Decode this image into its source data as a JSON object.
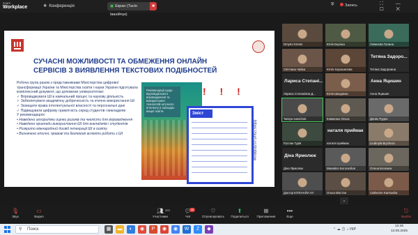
{
  "app": {
    "logo_line1": "zoom",
    "logo_line2": "Workplace",
    "conference_label": "Конференція",
    "screen_share_label": "Екран (Тасія Іванійчук)"
  },
  "topbar": {
    "record_label": "Запись"
  },
  "slide": {
    "title": "СУЧАСНІ МОЖЛИВОСТІ ТА ОБМЕЖЕННЯ ОНЛАЙН СЕРВІСІВ З ВИЯВЛЕННЯ ТЕКСТОВИХ ПОДІБНОСТЕЙ",
    "paragraph": "Робоча група разом з представниками Міністерства цифрової трансформації України та Міністерства освіти і науки України підготувала комплексний документ, що допоможе університетам:",
    "bullets": [
      "Впроваджувати ШІ в навчальний процес та наукову діяльність",
      "Забезпечувати академічну доброчесність та етичне використання ШІ",
      "Захищати права інтелектуальної власності та персональні дані",
      "Підвищувати цифрову грамотність серед студентів і викладачів"
    ],
    "recommendations_heading": "У рекомендаціях:",
    "recommendations": [
      "Наведено алгоритми оцінки ризиків та чеклісти для впровадження",
      "Наведено приклади використання ШІ для викладачів і студентів",
      "Розкрито міжнародний досвід інтеграції ШІ в освіту",
      "Визначено етичні, правові та безпекові аспекти роботи з ШІ"
    ],
    "doc_cover_text": "Рекомендації щодо відповідального впровадження та використання технологій штучного інтелекту в закладах вищої освіти",
    "toc_title": "Зміст",
    "vertical_url": "https://surl.cc/dobbow",
    "red_marks": "! ! !"
  },
  "participants": [
    {
      "name": "Dmytro Kmets",
      "kind": "video",
      "color": "#5a4a3e"
    },
    {
      "name": "Юлія Берізко",
      "kind": "video",
      "color": "#4f5a44"
    },
    {
      "name": "Ловкеєва Галина",
      "kind": "video",
      "color": "#3b6b5a"
    },
    {
      "name": "Світлана Чайка",
      "kind": "video",
      "color": "#6b5548"
    },
    {
      "name": "Юлія Хорошилова",
      "kind": "video",
      "color": "#5b4638"
    },
    {
      "name": "Тетяна Задоро...",
      "kind": "avatar",
      "sub": "Тетяна Задорожна"
    },
    {
      "name": "Лариса Степані...",
      "kind": "avatar",
      "sub": "Лариса Степанівна Д..."
    },
    {
      "name": "Юлія Шкодянко",
      "kind": "video",
      "color": "#7a5d4a"
    },
    {
      "name": "Анна Яцишин",
      "kind": "avatar",
      "sub": "Анна Яцишин"
    },
    {
      "name": "Taisiya Ivanichuk",
      "kind": "video",
      "color": "#4a4a4a",
      "active": true
    },
    {
      "name": "Клименко Ольга",
      "kind": "video",
      "color": "#5e5a52"
    },
    {
      "name": "Денис Руден",
      "kind": "video",
      "color": "#6a6a6a"
    },
    {
      "name": "Руслан Гурів",
      "kind": "video",
      "color": "#3d4a3f"
    },
    {
      "name": "наталя приймак",
      "kind": "avatar",
      "sub": "наталя приймак"
    },
    {
      "name": "Liudmyla Brychera",
      "kind": "video",
      "color": "#8a7a6a"
    },
    {
      "name": "Діна Ярмолюк",
      "kind": "avatar",
      "sub": "Діна Ярмолюк"
    },
    {
      "name": "Михайло Боголюбов",
      "kind": "video",
      "color": "#5a5a5a"
    },
    {
      "name": "Олена Блохнюк",
      "kind": "video",
      "color": "#6b665e"
    },
    {
      "name": "Доктор ЮТЕНАЙЛ ХУ",
      "kind": "video",
      "color": "#4e4e4e"
    },
    {
      "name": "Ольга Вінстан",
      "kind": "video",
      "color": "#5b4e44"
    },
    {
      "name": "Catherine Karmasha",
      "kind": "video",
      "color": "#7b5a4a"
    }
  ],
  "toolbar": {
    "audio": "Звук",
    "video": "Видео",
    "participants": "Участники",
    "participants_count": "329",
    "chat": "Чат",
    "chat_badge": "42",
    "react": "Отреагировать",
    "share": "Поделиться",
    "apps": "Приложения",
    "more": "Еще",
    "leave": "Выйти"
  },
  "taskbar": {
    "search_placeholder": "Поиск",
    "language": "УКР",
    "time": "12:45",
    "date": "13.05.2025"
  }
}
